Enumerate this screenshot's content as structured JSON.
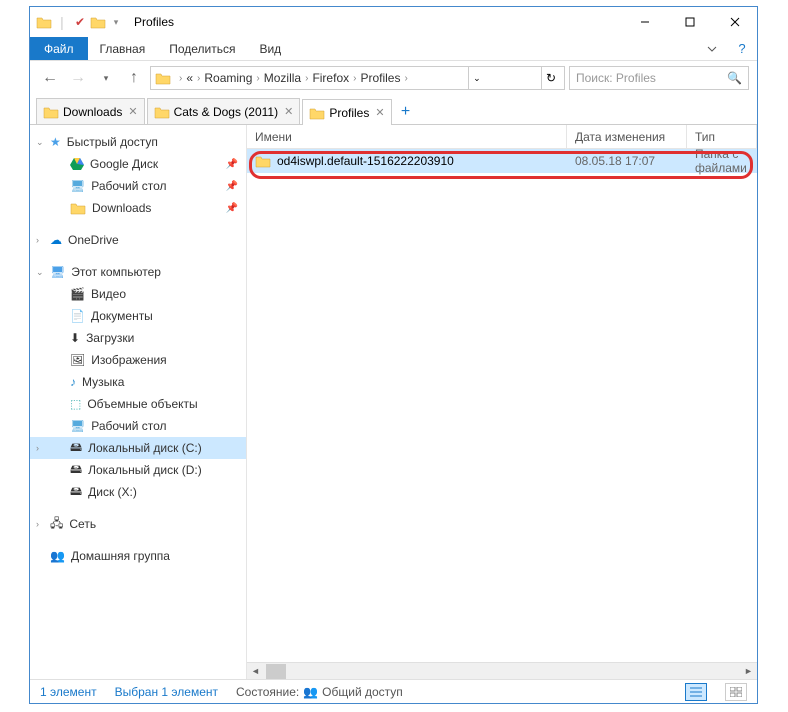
{
  "title": "Profiles",
  "ribbon": {
    "file": "Файл",
    "tabs": [
      "Главная",
      "Поделиться",
      "Вид"
    ]
  },
  "breadcrumb": {
    "items": [
      "Roaming",
      "Mozilla",
      "Firefox",
      "Profiles"
    ]
  },
  "search": {
    "placeholder": "Поиск: Profiles"
  },
  "tabs": [
    {
      "label": "Downloads",
      "active": false
    },
    {
      "label": "Cats & Dogs (2011)",
      "active": false
    },
    {
      "label": "Profiles",
      "active": true
    }
  ],
  "nav": {
    "quick": {
      "label": "Быстрый доступ",
      "items": [
        {
          "label": "Google Диск",
          "icon": "gdrive",
          "pin": true
        },
        {
          "label": "Рабочий стол",
          "icon": "desktop",
          "pin": true
        },
        {
          "label": "Downloads",
          "icon": "folder",
          "pin": true
        }
      ]
    },
    "onedrive": "OneDrive",
    "pc": {
      "label": "Этот компьютер",
      "items": [
        {
          "label": "Видео",
          "icon": "video"
        },
        {
          "label": "Документы",
          "icon": "docs"
        },
        {
          "label": "Загрузки",
          "icon": "downloads"
        },
        {
          "label": "Изображения",
          "icon": "images"
        },
        {
          "label": "Музыка",
          "icon": "music"
        },
        {
          "label": "Объемные объекты",
          "icon": "3d"
        },
        {
          "label": "Рабочий стол",
          "icon": "desktop"
        },
        {
          "label": "Локальный диск (C:)",
          "icon": "drive",
          "selected": true
        },
        {
          "label": "Локальный диск (D:)",
          "icon": "drive"
        },
        {
          "label": "Диск (X:)",
          "icon": "drive"
        }
      ]
    },
    "network": "Сеть",
    "homegroup": "Домашняя группа"
  },
  "columns": {
    "name": "Имени",
    "date": "Дата изменения",
    "type": "Тип"
  },
  "files": [
    {
      "name": "od4iswpl.default-1516222203910",
      "date": "08.05.18 17:07",
      "type": "Папка с файлами"
    }
  ],
  "status": {
    "count": "1 элемент",
    "selected": "Выбран 1 элемент",
    "state_label": "Состояние:",
    "state": "Общий доступ"
  }
}
